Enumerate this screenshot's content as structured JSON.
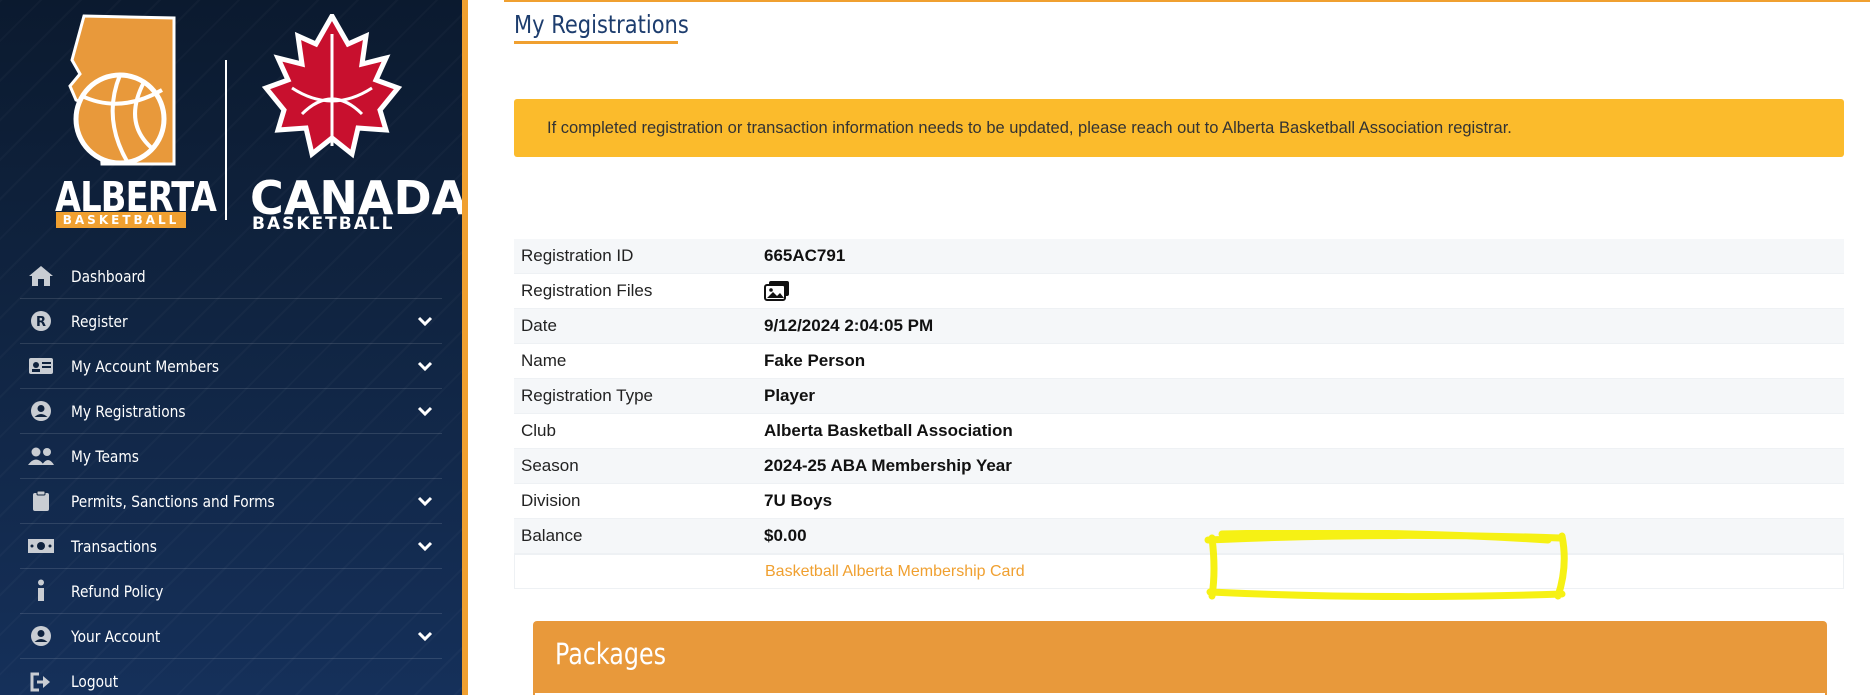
{
  "brand": {
    "alberta_word": "ALBERTA",
    "alberta_sub": "BASKETBALL",
    "canada_word": "CANADA",
    "canada_sub": "BASKETBALL",
    "accent_color": "#f0a030",
    "sidebar_color": "#0b1a2f",
    "maple_color": "#c8102e"
  },
  "nav": [
    {
      "label": "Dashboard",
      "icon": "home-icon",
      "has_submenu": false
    },
    {
      "label": "Register",
      "icon": "registered-r-icon",
      "has_submenu": true
    },
    {
      "label": "My Account Members",
      "icon": "id-card-icon",
      "has_submenu": true
    },
    {
      "label": "My Registrations",
      "icon": "user-circle-icon",
      "has_submenu": true
    },
    {
      "label": "My Teams",
      "icon": "users-icon",
      "has_submenu": false
    },
    {
      "label": "Permits, Sanctions and Forms",
      "icon": "clipboard-icon",
      "has_submenu": true
    },
    {
      "label": "Transactions",
      "icon": "money-bill-icon",
      "has_submenu": true
    },
    {
      "label": "Refund Policy",
      "icon": "info-icon",
      "has_submenu": false
    },
    {
      "label": "Your Account",
      "icon": "user-circle-icon",
      "has_submenu": true
    },
    {
      "label": "Logout",
      "icon": "sign-out-icon",
      "has_submenu": false
    }
  ],
  "page": {
    "title": "My Registrations",
    "alert": "If completed registration or transaction information needs to be updated, please reach out to Alberta Basketball Association registrar."
  },
  "details": {
    "registration_id": {
      "label": "Registration ID",
      "value": "665AC791"
    },
    "registration_files": {
      "label": "Registration Files",
      "icon": "images-icon"
    },
    "date": {
      "label": "Date",
      "value": "9/12/2024 2:04:05 PM"
    },
    "name": {
      "label": "Name",
      "value": "Fake Person"
    },
    "registration_type": {
      "label": "Registration Type",
      "value": "Player"
    },
    "club": {
      "label": "Club",
      "value": "Alberta Basketball Association"
    },
    "season": {
      "label": "Season",
      "value": "2024-25 ABA Membership Year"
    },
    "division": {
      "label": "Division",
      "value": "7U Boys"
    },
    "balance": {
      "label": "Balance",
      "value": "$0.00"
    },
    "membership_card_link": "Basketball Alberta Membership Card"
  },
  "packages": {
    "title": "Packages"
  },
  "annotation": {
    "highlight_color": "#f5f000"
  }
}
